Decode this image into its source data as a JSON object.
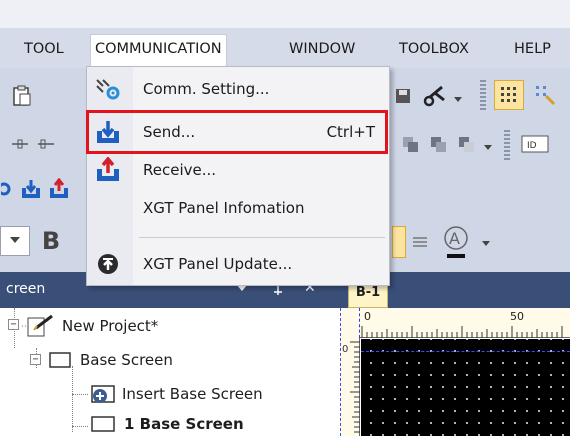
{
  "menubar": {
    "items": [
      "TOOL",
      "COMMUNICATION",
      "WINDOW",
      "TOOLBOX",
      "HELP"
    ],
    "active": "COMMUNICATION"
  },
  "communication_menu": {
    "items": [
      {
        "label": "Comm. Setting...",
        "shortcut": "",
        "icon": "comm-setting-icon"
      },
      {
        "label": "Send...",
        "shortcut": "Ctrl+T",
        "icon": "send-download-icon"
      },
      {
        "label": "Receive...",
        "shortcut": "",
        "icon": "receive-upload-icon"
      },
      {
        "label": "XGT Panel Infomation",
        "shortcut": "",
        "icon": ""
      },
      {
        "label": "XGT Panel Update...",
        "shortcut": "",
        "icon": "panel-update-icon"
      }
    ],
    "highlighted": "Send..."
  },
  "toolbar": {
    "bold_label": "B"
  },
  "screen_panel": {
    "title": "creen",
    "pin_glyph": "⬇",
    "close_glyph": "✕",
    "tree": [
      {
        "label": "New Project*",
        "level": 0
      },
      {
        "label": "Base Screen",
        "level": 1
      },
      {
        "label": "Insert Base Screen",
        "level": 2
      },
      {
        "label": "1 Base Screen",
        "level": 2
      }
    ]
  },
  "editor": {
    "tab_label": "B-1",
    "ruler_labels": [
      "0",
      "50"
    ]
  },
  "colors": {
    "menubar_bg": "#d6dbe9",
    "panel_header": "#3a4f78",
    "highlight_red": "#e2131b",
    "send_blue": "#1f5fbf",
    "receive_red": "#d4202a"
  }
}
